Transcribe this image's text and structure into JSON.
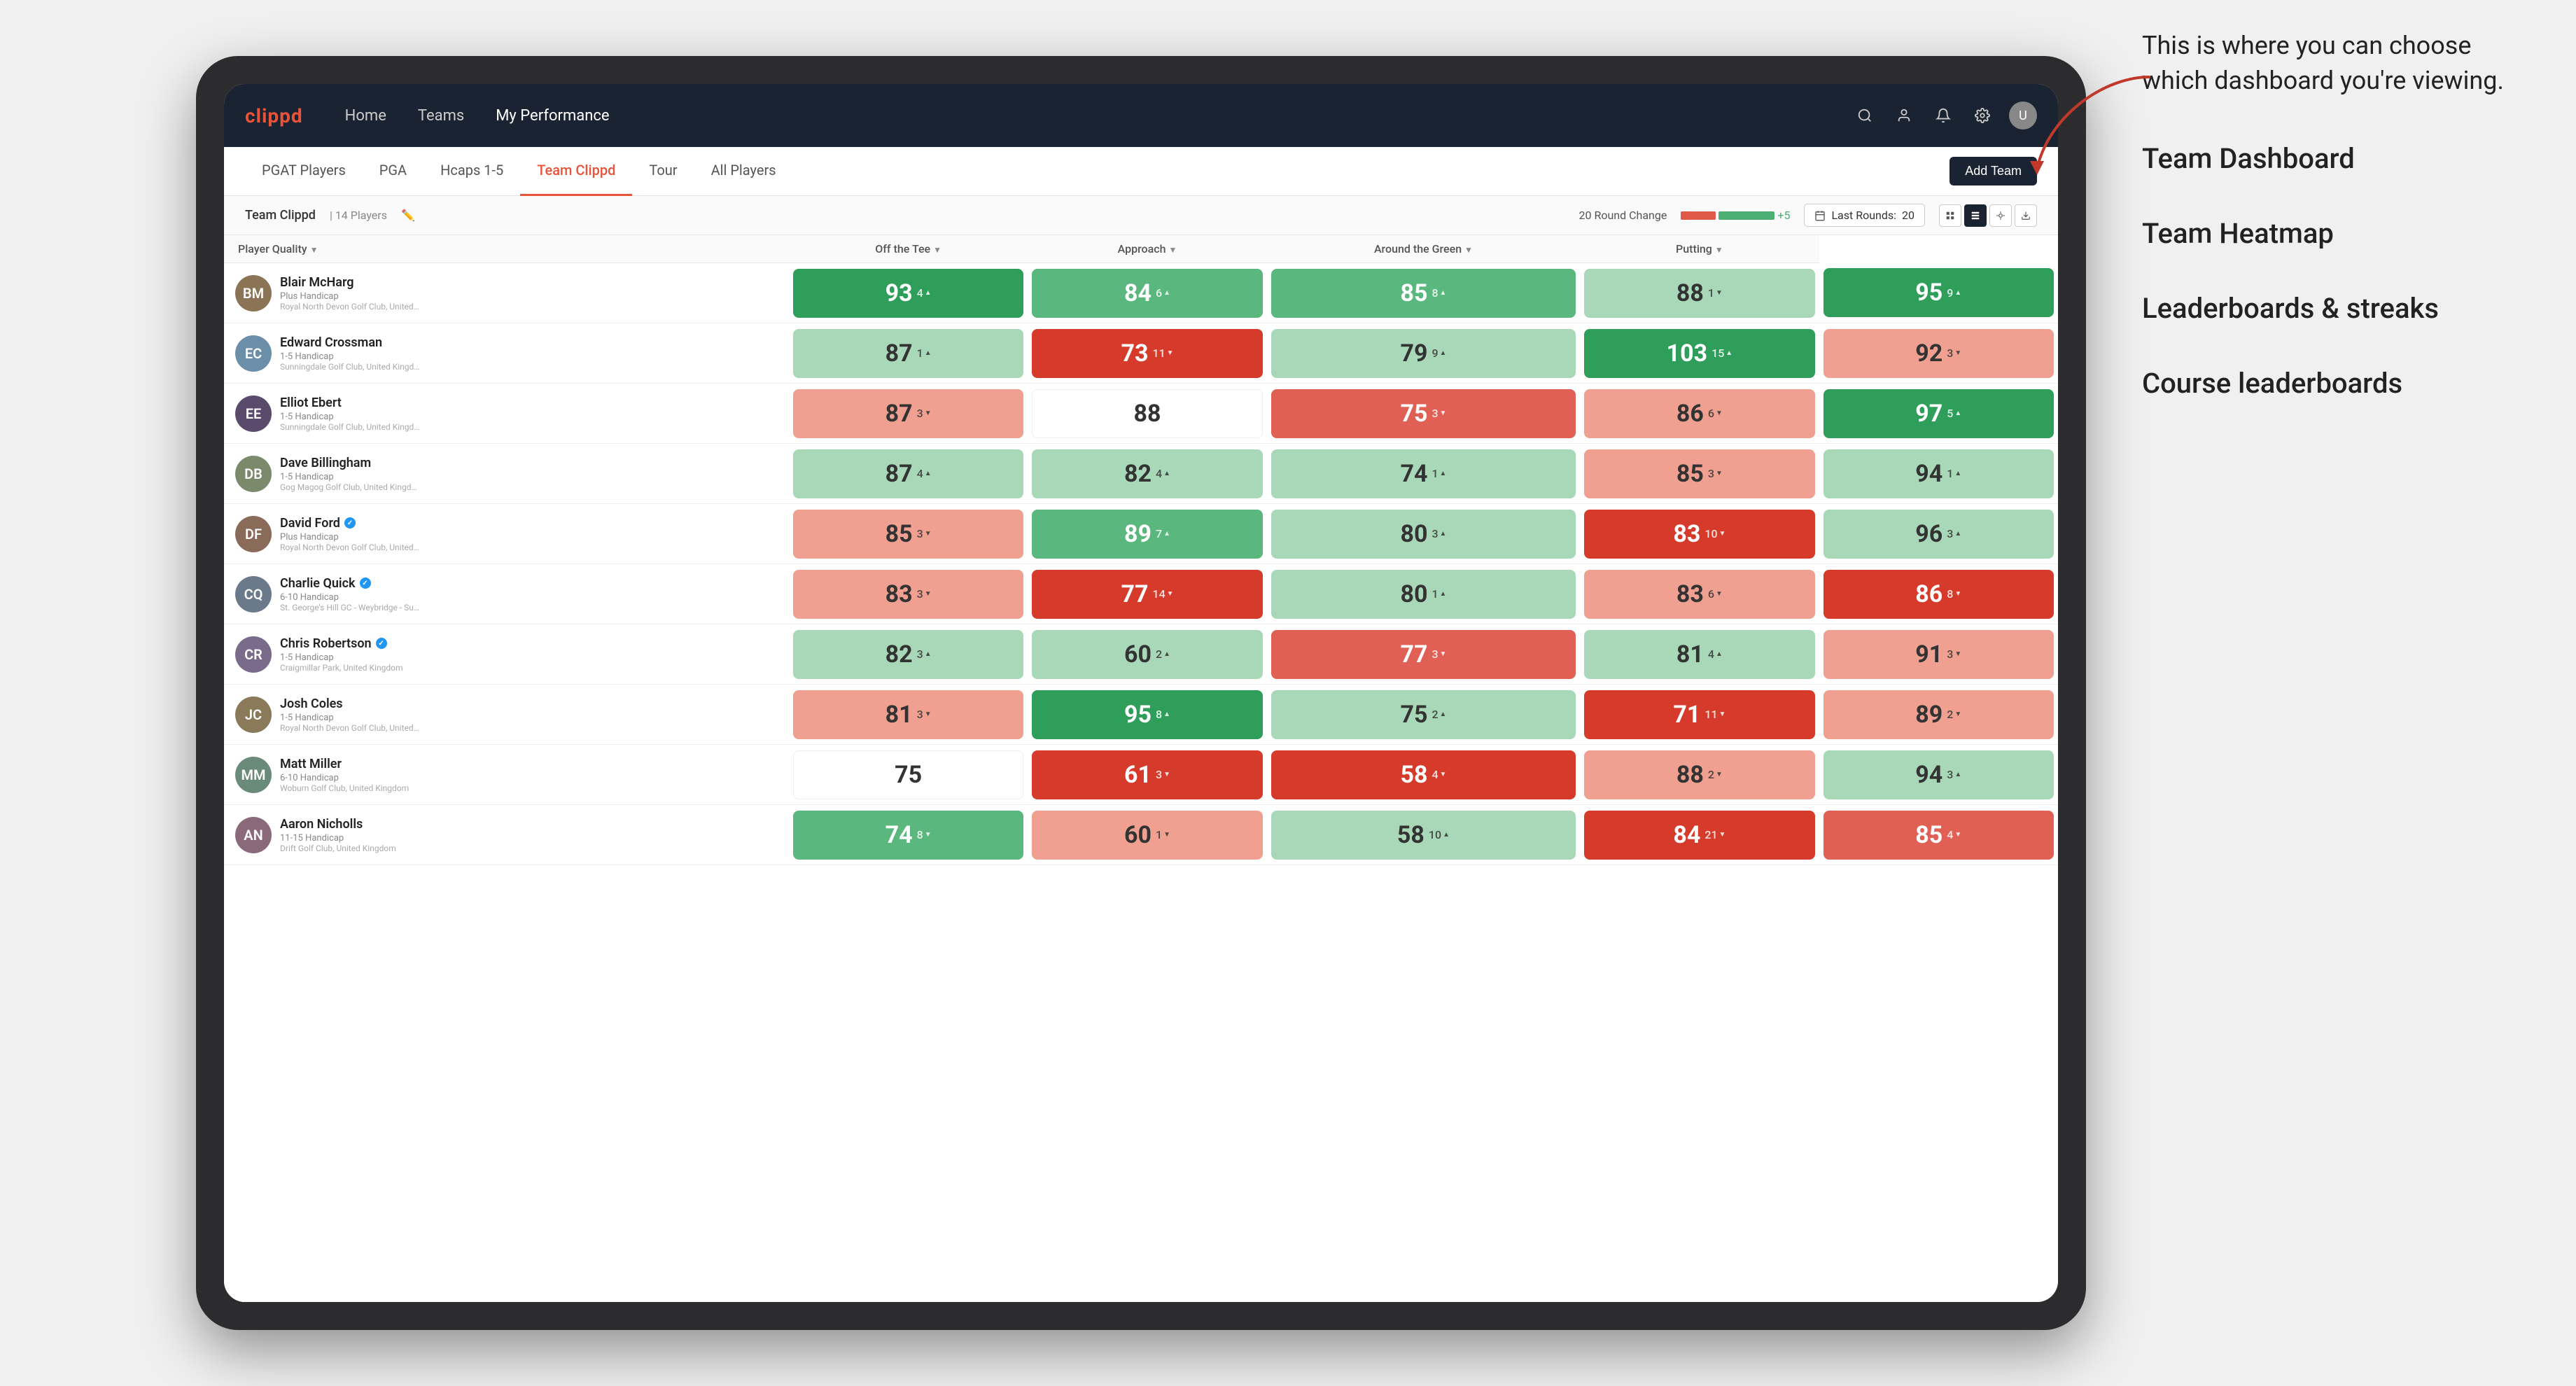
{
  "annotation": {
    "intro": "This is where you can choose which dashboard you're viewing.",
    "menu_items": [
      "Team Dashboard",
      "Team Heatmap",
      "Leaderboards & streaks",
      "Course leaderboards"
    ]
  },
  "nav": {
    "logo": "clippd",
    "links": [
      "Home",
      "Teams",
      "My Performance"
    ],
    "active_link": "My Performance"
  },
  "sub_tabs": {
    "tabs": [
      "PGAT Players",
      "PGA",
      "Hcaps 1-5",
      "Team Clippd",
      "Tour",
      "All Players"
    ],
    "active": "Team Clippd",
    "add_team_label": "Add Team"
  },
  "team_bar": {
    "team_name": "Team Clippd",
    "separator": "|",
    "player_count": "14 Players",
    "round_change_label": "20 Round Change",
    "change_value": "-5",
    "change_plus": "+5",
    "last_rounds_label": "Last Rounds:",
    "last_rounds_value": "20"
  },
  "table": {
    "headers": [
      {
        "label": "Player Quality",
        "key": "player_quality",
        "sortable": true
      },
      {
        "label": "Off the Tee",
        "key": "off_tee",
        "sortable": true
      },
      {
        "label": "Approach",
        "key": "approach",
        "sortable": true
      },
      {
        "label": "Around the Green",
        "key": "around_green",
        "sortable": true
      },
      {
        "label": "Putting",
        "key": "putting",
        "sortable": true
      }
    ],
    "players": [
      {
        "name": "Blair McHarg",
        "handicap": "Plus Handicap",
        "club": "Royal North Devon Golf Club, United Kingdom",
        "initials": "BM",
        "avatar_color": "#8B7355",
        "scores": [
          {
            "value": 93,
            "change": 4,
            "trend": "up",
            "color": "green-dark"
          },
          {
            "value": 84,
            "change": 6,
            "trend": "up",
            "color": "green-mid"
          },
          {
            "value": 85,
            "change": 8,
            "trend": "up",
            "color": "green-mid"
          },
          {
            "value": 88,
            "change": 1,
            "trend": "down",
            "color": "green-light"
          },
          {
            "value": 95,
            "change": 9,
            "trend": "up",
            "color": "green-dark"
          }
        ]
      },
      {
        "name": "Edward Crossman",
        "handicap": "1-5 Handicap",
        "club": "Sunningdale Golf Club, United Kingdom",
        "initials": "EC",
        "avatar_color": "#6B8FA8",
        "scores": [
          {
            "value": 87,
            "change": 1,
            "trend": "up",
            "color": "green-light"
          },
          {
            "value": 73,
            "change": 11,
            "trend": "down",
            "color": "red-dark"
          },
          {
            "value": 79,
            "change": 9,
            "trend": "up",
            "color": "green-light"
          },
          {
            "value": 103,
            "change": 15,
            "trend": "up",
            "color": "green-dark"
          },
          {
            "value": 92,
            "change": 3,
            "trend": "down",
            "color": "red-light"
          }
        ]
      },
      {
        "name": "Elliot Ebert",
        "handicap": "1-5 Handicap",
        "club": "Sunningdale Golf Club, United Kingdom",
        "initials": "EE",
        "avatar_color": "#5A4A6B",
        "scores": [
          {
            "value": 87,
            "change": 3,
            "trend": "down",
            "color": "red-light"
          },
          {
            "value": 88,
            "change": null,
            "trend": null,
            "color": "white"
          },
          {
            "value": 75,
            "change": 3,
            "trend": "down",
            "color": "red-mid"
          },
          {
            "value": 86,
            "change": 6,
            "trend": "down",
            "color": "red-light"
          },
          {
            "value": 97,
            "change": 5,
            "trend": "up",
            "color": "green-dark"
          }
        ]
      },
      {
        "name": "Dave Billingham",
        "handicap": "1-5 Handicap",
        "club": "Gog Magog Golf Club, United Kingdom",
        "initials": "DB",
        "avatar_color": "#7A8A6B",
        "scores": [
          {
            "value": 87,
            "change": 4,
            "trend": "up",
            "color": "green-light"
          },
          {
            "value": 82,
            "change": 4,
            "trend": "up",
            "color": "green-light"
          },
          {
            "value": 74,
            "change": 1,
            "trend": "up",
            "color": "green-light"
          },
          {
            "value": 85,
            "change": 3,
            "trend": "down",
            "color": "red-light"
          },
          {
            "value": 94,
            "change": 1,
            "trend": "up",
            "color": "green-light"
          }
        ]
      },
      {
        "name": "David Ford",
        "handicap": "Plus Handicap",
        "club": "Royal North Devon Golf Club, United Kingdom",
        "initials": "DF",
        "verified": true,
        "avatar_color": "#8A6B5A",
        "scores": [
          {
            "value": 85,
            "change": 3,
            "trend": "down",
            "color": "red-light"
          },
          {
            "value": 89,
            "change": 7,
            "trend": "up",
            "color": "green-mid"
          },
          {
            "value": 80,
            "change": 3,
            "trend": "up",
            "color": "green-light"
          },
          {
            "value": 83,
            "change": 10,
            "trend": "down",
            "color": "red-dark"
          },
          {
            "value": 96,
            "change": 3,
            "trend": "up",
            "color": "green-light"
          }
        ]
      },
      {
        "name": "Charlie Quick",
        "handicap": "6-10 Handicap",
        "club": "St. George's Hill GC - Weybridge - Surrey, Uni...",
        "initials": "CQ",
        "verified": true,
        "avatar_color": "#6B7A8A",
        "scores": [
          {
            "value": 83,
            "change": 3,
            "trend": "down",
            "color": "red-light"
          },
          {
            "value": 77,
            "change": 14,
            "trend": "down",
            "color": "red-dark"
          },
          {
            "value": 80,
            "change": 1,
            "trend": "up",
            "color": "green-light"
          },
          {
            "value": 83,
            "change": 6,
            "trend": "down",
            "color": "red-light"
          },
          {
            "value": 86,
            "change": 8,
            "trend": "down",
            "color": "red-dark"
          }
        ]
      },
      {
        "name": "Chris Robertson",
        "handicap": "1-5 Handicap",
        "club": "Craigmillar Park, United Kingdom",
        "initials": "CR",
        "verified": true,
        "avatar_color": "#7A6B8A",
        "scores": [
          {
            "value": 82,
            "change": 3,
            "trend": "up",
            "color": "green-light"
          },
          {
            "value": 60,
            "change": 2,
            "trend": "up",
            "color": "green-light"
          },
          {
            "value": 77,
            "change": 3,
            "trend": "down",
            "color": "red-mid"
          },
          {
            "value": 81,
            "change": 4,
            "trend": "up",
            "color": "green-light"
          },
          {
            "value": 91,
            "change": 3,
            "trend": "down",
            "color": "red-light"
          }
        ]
      },
      {
        "name": "Josh Coles",
        "handicap": "1-5 Handicap",
        "club": "Royal North Devon Golf Club, United Kingdom",
        "initials": "JC",
        "avatar_color": "#8A7A5A",
        "scores": [
          {
            "value": 81,
            "change": 3,
            "trend": "down",
            "color": "red-light"
          },
          {
            "value": 95,
            "change": 8,
            "trend": "up",
            "color": "green-dark"
          },
          {
            "value": 75,
            "change": 2,
            "trend": "up",
            "color": "green-light"
          },
          {
            "value": 71,
            "change": 11,
            "trend": "down",
            "color": "red-dark"
          },
          {
            "value": 89,
            "change": 2,
            "trend": "down",
            "color": "red-light"
          }
        ]
      },
      {
        "name": "Matt Miller",
        "handicap": "6-10 Handicap",
        "club": "Woburn Golf Club, United Kingdom",
        "initials": "MM",
        "avatar_color": "#6A8A7A",
        "scores": [
          {
            "value": 75,
            "change": null,
            "trend": null,
            "color": "white"
          },
          {
            "value": 61,
            "change": 3,
            "trend": "down",
            "color": "red-dark"
          },
          {
            "value": 58,
            "change": 4,
            "trend": "down",
            "color": "red-dark"
          },
          {
            "value": 88,
            "change": 2,
            "trend": "down",
            "color": "red-light"
          },
          {
            "value": 94,
            "change": 3,
            "trend": "up",
            "color": "green-light"
          }
        ]
      },
      {
        "name": "Aaron Nicholls",
        "handicap": "11-15 Handicap",
        "club": "Drift Golf Club, United Kingdom",
        "initials": "AN",
        "avatar_color": "#8A6A7A",
        "scores": [
          {
            "value": 74,
            "change": 8,
            "trend": "down",
            "color": "green-mid"
          },
          {
            "value": 60,
            "change": 1,
            "trend": "down",
            "color": "red-light"
          },
          {
            "value": 58,
            "change": 10,
            "trend": "up",
            "color": "green-light"
          },
          {
            "value": 84,
            "change": 21,
            "trend": "down",
            "color": "red-dark"
          },
          {
            "value": 85,
            "change": 4,
            "trend": "down",
            "color": "red-mid"
          }
        ]
      }
    ]
  }
}
